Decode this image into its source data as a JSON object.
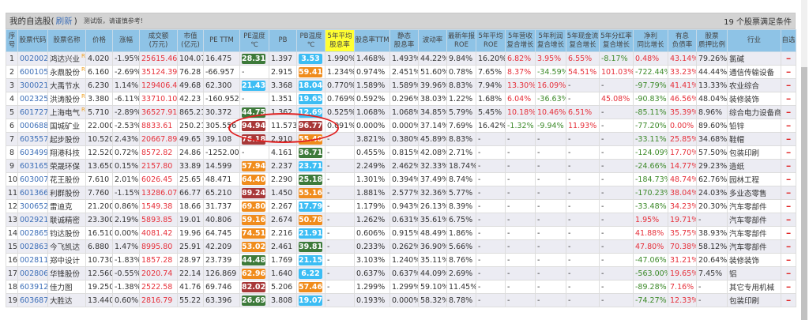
{
  "title": {
    "label": "我的自选股(",
    "refresh": "刷新",
    "close": ")",
    "note": "测试版，请谨慎参考!",
    "count": "19 个股票满足条件"
  },
  "colors": {
    "green": "#3d7a3a",
    "blue": "#3cbdf4",
    "orange": "#f08c1c",
    "red": "#a83838"
  },
  "headers": [
    "序号",
    "股票代码",
    "股票名称",
    "价格",
    "涨幅",
    "成交额\n(万元)",
    "市值\n(亿元)",
    "PE TTM",
    "PE温度\n℃",
    "PB",
    "PB温度\n℃",
    "5年平均\n股息率",
    "股息率TTM",
    "静态\n股息率",
    "波动率",
    "最新年报\nROE",
    "5年平均\nROE",
    "5年营收\n复合增长",
    "5年利润\n复合增长",
    "5年现金流\n复合增长",
    "5年分红率\n复合增长",
    "净利\n同比增长",
    "有息\n负债率",
    "股票\n质押比例",
    "行业",
    "自选"
  ],
  "rows": [
    [
      "1",
      "002002",
      "鸿达兴业",
      true,
      "4.020",
      "-1.95%",
      "25615.46",
      "104.07",
      "16.475",
      [
        "28.31",
        "green"
      ],
      "1.397",
      [
        "3.53",
        "blue"
      ],
      "1.990%",
      "1.468%",
      "1.493%",
      "44.22%",
      "9.84%",
      "16.20%",
      "6.82%",
      "3.95%",
      "6.55%",
      "-8.17%",
      "0.48%",
      "43.14%",
      "79.26%",
      "氯碱"
    ],
    [
      "2",
      "600105",
      "永鼎股份",
      true,
      "6.160",
      "-2.69%",
      "35124.39",
      "76.28",
      "-66.957",
      "-",
      "2.915",
      [
        "59.41",
        "orange"
      ],
      "1.234%",
      "0.974%",
      "2.451%",
      "51.60%",
      "0.78%",
      "7.65%",
      "8.37%",
      "-34.59%",
      "54.51%",
      "101.03%",
      "-722.44%",
      "33.23%",
      "44.44%",
      "通信传输设备"
    ],
    [
      "3",
      "300021",
      "大禹节水",
      false,
      "6.230",
      "1.14%",
      "129406.47",
      "49.68",
      "62.300",
      [
        "21.43",
        "blue"
      ],
      "3.368",
      [
        "18.04",
        "blue"
      ],
      "0.770%",
      "1.589%",
      "1.589%",
      "39.96%",
      "8.83%",
      "7.94%",
      "13.30%",
      "16.09%",
      "-",
      "-",
      "-97.79%",
      "41.41%",
      "13.33%",
      "农业综合"
    ],
    [
      "4",
      "002325",
      "洪涛股份",
      true,
      "3.380",
      "-6.11%",
      "33710.10",
      "42.23",
      "-160.952",
      "-",
      "1.351",
      [
        "19.65",
        "blue"
      ],
      "0.769%",
      "0.592%",
      "0.296%",
      "38.03%",
      "1.22%",
      "1.68%",
      "6.04%",
      "-36.63%",
      "-",
      "45.08%",
      "-90.83%",
      "46.56%",
      "48.04%",
      "装修装饰"
    ],
    [
      "5",
      "601727",
      "上海电气",
      true,
      "5.710",
      "-2.89%",
      "36527.91",
      "865.21",
      "30.372",
      [
        "44.75",
        "green"
      ],
      "1.362",
      [
        "12.69",
        "blue"
      ],
      "0.525%",
      "1.068%",
      "1.068%",
      "34.85%",
      "5.79%",
      "5.45%",
      "10.18%",
      "10.46%",
      "6.51%",
      "-",
      "-85.11%",
      "35.39%",
      "8.96%",
      "综合电力设备商"
    ],
    [
      "6",
      "000688",
      "国城矿业",
      false,
      "22.000",
      "-2.53%",
      "8833.61",
      "250.21",
      "305.556",
      [
        "94.94",
        "red"
      ],
      "11.573",
      [
        "96.77",
        "red"
      ],
      "0.091%",
      "0.000%",
      "0.000%",
      "37.14%",
      "7.69%",
      "16.42%",
      "-1.32%",
      "-9.94%",
      "11.93%",
      "-",
      "-77.20%",
      "0.00%",
      "89.60%",
      "铅锌"
    ],
    [
      "7",
      "603557",
      "起步股份",
      false,
      "10.520",
      "2.43%",
      "20667.89",
      "49.65",
      "39.108",
      [
        "76.18",
        "red"
      ],
      "2.910",
      [
        "55.40",
        "orange"
      ],
      "-",
      "3.821%",
      "0.380%",
      "45.89%",
      "8.83%",
      "-",
      "-",
      "-",
      "-",
      "-",
      "-33.11%",
      "25.85%",
      "34.68%",
      "鞋帽"
    ],
    [
      "8",
      "603499",
      "翔港科技",
      false,
      "12.520",
      "0.72%",
      "8572.82",
      "24.86",
      "-1252.000",
      "-",
      "4.161",
      [
        "36.71",
        "green"
      ],
      "-",
      "0.455%",
      "0.815%",
      "42.08%",
      "2.71%",
      "-",
      "-",
      "-",
      "-",
      "-",
      "-124.09%",
      "17.70%",
      "57.50%",
      "包装印刷"
    ],
    [
      "9",
      "603165",
      "荣晟环保",
      false,
      "13.650",
      "0.15%",
      "2157.80",
      "33.89",
      "14.599",
      [
        "57.94",
        "orange"
      ],
      "2.237",
      [
        "23.71",
        "blue"
      ],
      "-",
      "2.249%",
      "2.462%",
      "32.33%",
      "18.74%",
      "-",
      "-",
      "-",
      "-",
      "-",
      "-24.66%",
      "14.77%",
      "29.23%",
      "造纸"
    ],
    [
      "10",
      "603007",
      "花王股份",
      false,
      "7.610",
      "2.01%",
      "6026.45",
      "25.65",
      "48.471",
      [
        "64.40",
        "orange"
      ],
      "2.290",
      [
        "25.18",
        "green"
      ],
      "-",
      "1.301%",
      "0.394%",
      "37.49%",
      "8.74%",
      "-",
      "-",
      "-",
      "-",
      "-",
      "-184.73%",
      "48.74%",
      "62.76%",
      "园林工程"
    ],
    [
      "11",
      "601366",
      "利群股份",
      false,
      "7.760",
      "-1.15%",
      "13286.07",
      "66.77",
      "65.210",
      [
        "89.24",
        "red"
      ],
      "1.450",
      [
        "55.16",
        "orange"
      ],
      "-",
      "1.881%",
      "2.577%",
      "32.36%",
      "5.77%",
      "-",
      "-",
      "-",
      "-",
      "-",
      "-170.23%",
      "38.04%",
      "24.03%",
      "多业态零售"
    ],
    [
      "12",
      "300652",
      "雷迪克",
      false,
      "21.200",
      "0.86%",
      "1549.38",
      "18.66",
      "31.737",
      [
        "69.80",
        "orange"
      ],
      "2.267",
      [
        "17.79",
        "blue"
      ],
      "-",
      "1.179%",
      "0.943%",
      "26.13%",
      "8.39%",
      "-",
      "-",
      "-",
      "-",
      "-",
      "-33.48%",
      "34.23%",
      "20.30%",
      "汽车零部件"
    ],
    [
      "13",
      "002921",
      "联诚精密",
      false,
      "23.300",
      "2.19%",
      "5893.85",
      "19.01",
      "40.806",
      [
        "59.16",
        "orange"
      ],
      "2.674",
      [
        "50.78",
        "orange"
      ],
      "-",
      "1.262%",
      "0.631%",
      "35.61%",
      "6.75%",
      "-",
      "-",
      "-",
      "-",
      "-",
      "1.95%",
      "19.71%",
      "-",
      "汽车零部件"
    ],
    [
      "14",
      "002865",
      "钧达股份",
      false,
      "16.510",
      "0.00%",
      "4081.42",
      "19.96",
      "64.745",
      [
        "74.51",
        "orange"
      ],
      "2.216",
      [
        "21.91",
        "blue"
      ],
      "-",
      "0.606%",
      "0.915%",
      "48.49%",
      "1.86%",
      "-",
      "-",
      "-",
      "-",
      "-",
      "41.88%",
      "35.75%",
      "38.93%",
      "汽车零部件"
    ],
    [
      "15",
      "002863",
      "今飞凯达",
      false,
      "6.880",
      "1.47%",
      "8995.80",
      "25.91",
      "42.209",
      [
        "53.02",
        "orange"
      ],
      "2.461",
      [
        "39.81",
        "green"
      ],
      "-",
      "0.233%",
      "0.262%",
      "36.90%",
      "5.66%",
      "-",
      "-",
      "-",
      "-",
      "-",
      "47.80%",
      "70.38%",
      "58.12%",
      "汽车零部件"
    ],
    [
      "16",
      "002811",
      "郑中设计",
      false,
      "10.730",
      "-1.83%",
      "1857.28",
      "28.97",
      "23.739",
      [
        "44.48",
        "green"
      ],
      "1.769",
      [
        "21.15",
        "blue"
      ],
      "-",
      "3.103%",
      "1.240%",
      "35.11%",
      "8.76%",
      "-",
      "-",
      "-",
      "-",
      "-",
      "-47.06%",
      "31.21%",
      "20.64%",
      "装修装饰"
    ],
    [
      "17",
      "002806",
      "华锋股份",
      false,
      "12.560",
      "-0.55%",
      "2020.74",
      "22.14",
      "126.869",
      [
        "62.96",
        "orange"
      ],
      "1.640",
      [
        "6.22",
        "blue"
      ],
      "-",
      "0.637%",
      "0.637%",
      "44.09%",
      "2.69%",
      "-",
      "-",
      "-",
      "-",
      "-",
      "-563.00%",
      "19.65%",
      "7.45%",
      "铝"
    ],
    [
      "18",
      "603912",
      "佳力图",
      false,
      "19.250",
      "-1.38%",
      "2522.58",
      "41.76",
      "69.746",
      [
        "82.02",
        "red"
      ],
      "5.206",
      [
        "57.46",
        "orange"
      ],
      "-",
      "1.299%",
      "1.299%",
      "59.10%",
      "11.45%",
      "-",
      "-",
      "-",
      "-",
      "-",
      "-89.28%",
      "7.16%",
      "-",
      "其它专用机械"
    ],
    [
      "19",
      "603687",
      "大胜达",
      false,
      "13.440",
      "0.60%",
      "2816.79",
      "55.22",
      "63.396",
      [
        "26.69",
        "green"
      ],
      "3.808",
      [
        "19.07",
        "blue"
      ],
      "-",
      "0.193%",
      "0.000%",
      "58.32%",
      "8.78%",
      "-",
      "-",
      "-",
      "-",
      "-",
      "-74.27%",
      "12.33%",
      "-",
      "包装印刷"
    ]
  ],
  "r_mark": "R",
  "remove_icon": "minus-icon"
}
